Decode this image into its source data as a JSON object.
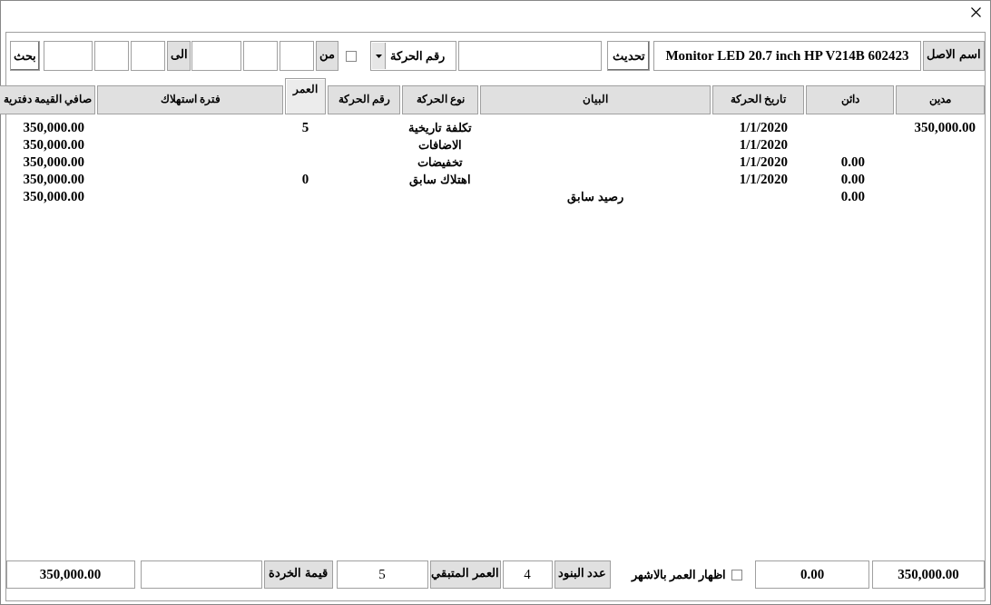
{
  "toolbar": {
    "asset_label": "اسم الاصل",
    "asset_name": "Monitor LED 20.7 inch HP V214B 602423",
    "refresh_button": "تحديث",
    "type_combo": "رقم الحركة",
    "from_checkbox": {
      "checked": false
    },
    "from_label": "من",
    "to_label": "الى",
    "search_button": "بحث"
  },
  "table": {
    "columns": [
      {
        "label": "مدين",
        "selected": false
      },
      {
        "label": "دائن",
        "selected": false
      },
      {
        "label": "تاريخ الحركة",
        "selected": false
      },
      {
        "label": "البيان",
        "selected": false
      },
      {
        "label": "نوع الحركة",
        "selected": false
      },
      {
        "label": "رقم الحركة",
        "selected": false
      },
      {
        "label": "العمر",
        "selected": true
      },
      {
        "label": "فترة استهلاك",
        "selected": false
      },
      {
        "label": "صافي القيمة دفترية",
        "selected": false
      }
    ],
    "rows": [
      {
        "debit": "350,000.00",
        "date": "1/1/2020",
        "type": "تكلفة تاريخية",
        "age": "5",
        "net": "350,000.00"
      },
      {
        "date": "1/1/2020",
        "type": "الاضافات",
        "net": "350,000.00"
      },
      {
        "credit": "0.00",
        "date": "1/1/2020",
        "type": "تخفيضات",
        "net": "350,000.00"
      },
      {
        "credit": "0.00",
        "date": "1/1/2020",
        "type": "اهتلاك سابق",
        "age": "0",
        "net": "350,000.00"
      },
      {
        "credit": "0.00",
        "statement": "رصيد سابق",
        "net": "350,000.00"
      }
    ]
  },
  "footer": {
    "total_debit": "350,000.00",
    "total_credit": "0.00",
    "months_checkbox": {
      "label": "اظهار العمر بالاشهر",
      "checked": false
    },
    "items_count": {
      "label": "عدد البنود",
      "value": "4"
    },
    "remaining_life": {
      "label": "العمر المتبقي",
      "value": "5"
    },
    "scrap_value": {
      "label": "قيمة الخردة"
    },
    "net_value": "350,000.00"
  }
}
